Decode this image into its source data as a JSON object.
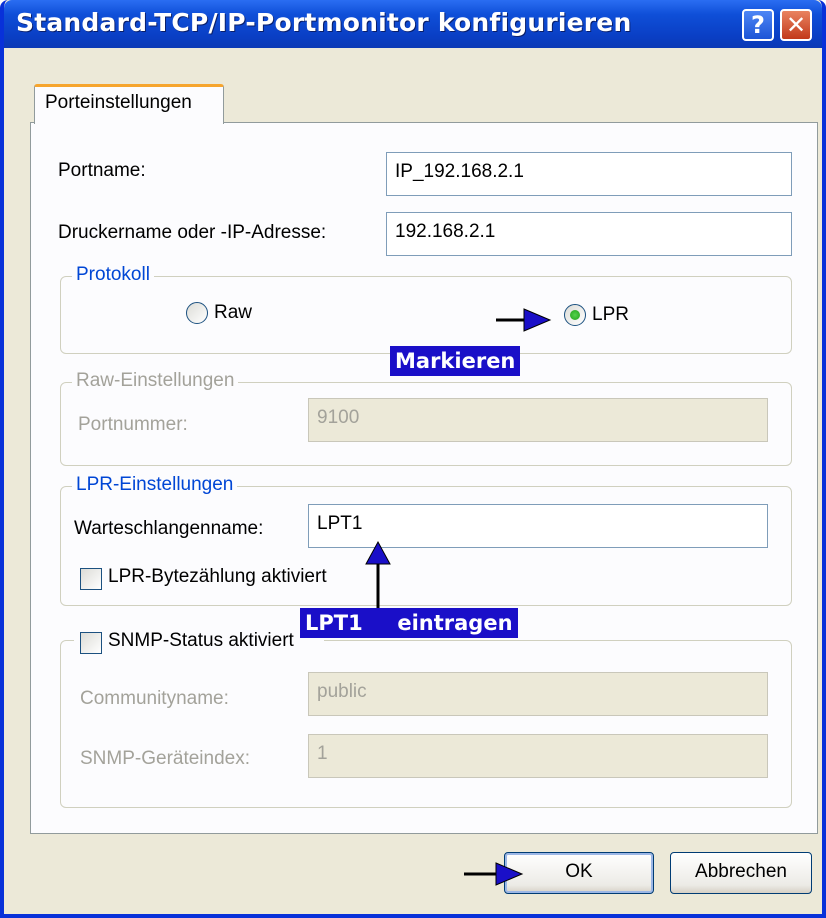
{
  "window": {
    "title": "Standard-TCP/IP-Portmonitor konfigurieren",
    "help_label": "?",
    "close_label": "✕"
  },
  "tab": {
    "label": "Porteinstellungen"
  },
  "fields": {
    "portname_label": "Portname:",
    "portname_value": "IP_192.168.2.1",
    "printer_label": "Druckername oder -IP-Adresse:",
    "printer_value": "192.168.2.1"
  },
  "protocol": {
    "legend": "Protokoll",
    "raw_label": "Raw",
    "lpr_label": "LPR",
    "selected": "LPR"
  },
  "raw_settings": {
    "legend": "Raw-Einstellungen",
    "port_label": "Portnummer:",
    "port_value": "9100"
  },
  "lpr_settings": {
    "legend": "LPR-Einstellungen",
    "queue_label": "Warteschlangenname:",
    "queue_value": "LPT1",
    "bytecount_label": "LPR-Bytezählung aktiviert",
    "bytecount_checked": false
  },
  "snmp": {
    "checkbox_label": "SNMP-Status aktiviert",
    "checked": false,
    "community_label": "Communityname:",
    "community_value": "public",
    "index_label": "SNMP-Geräteindex:",
    "index_value": "1"
  },
  "buttons": {
    "ok": "OK",
    "cancel": "Abbrechen"
  },
  "annotations": {
    "mark": "Markieren",
    "lpt1": "LPT1",
    "enter": "eintragen",
    "color": "#1a0fc8"
  }
}
